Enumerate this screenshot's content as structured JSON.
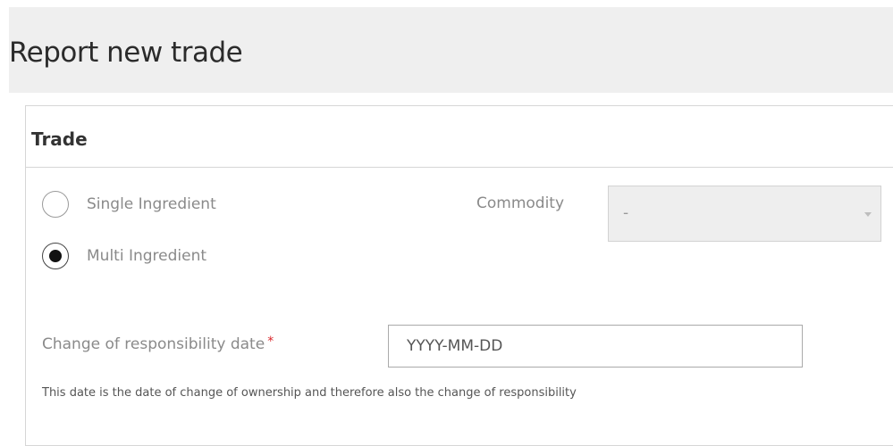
{
  "page": {
    "title": "Report new trade"
  },
  "trade_panel": {
    "heading": "Trade",
    "ingredient_options": [
      {
        "label": "Single Ingredient",
        "selected": false
      },
      {
        "label": "Multi Ingredient",
        "selected": true
      }
    ],
    "commodity": {
      "label": "Commodity",
      "value": "-",
      "disabled": true
    },
    "responsibility_date": {
      "label": "Change of responsibility date",
      "required_marker": "*",
      "placeholder": "YYYY-MM-DD",
      "value": "",
      "help_text": "This date is the date of change of ownership and therefore also the change of responsibility"
    }
  },
  "colors": {
    "header_background": "#efefef",
    "required_marker": "#d9262a",
    "border": "#d6d6d6"
  }
}
